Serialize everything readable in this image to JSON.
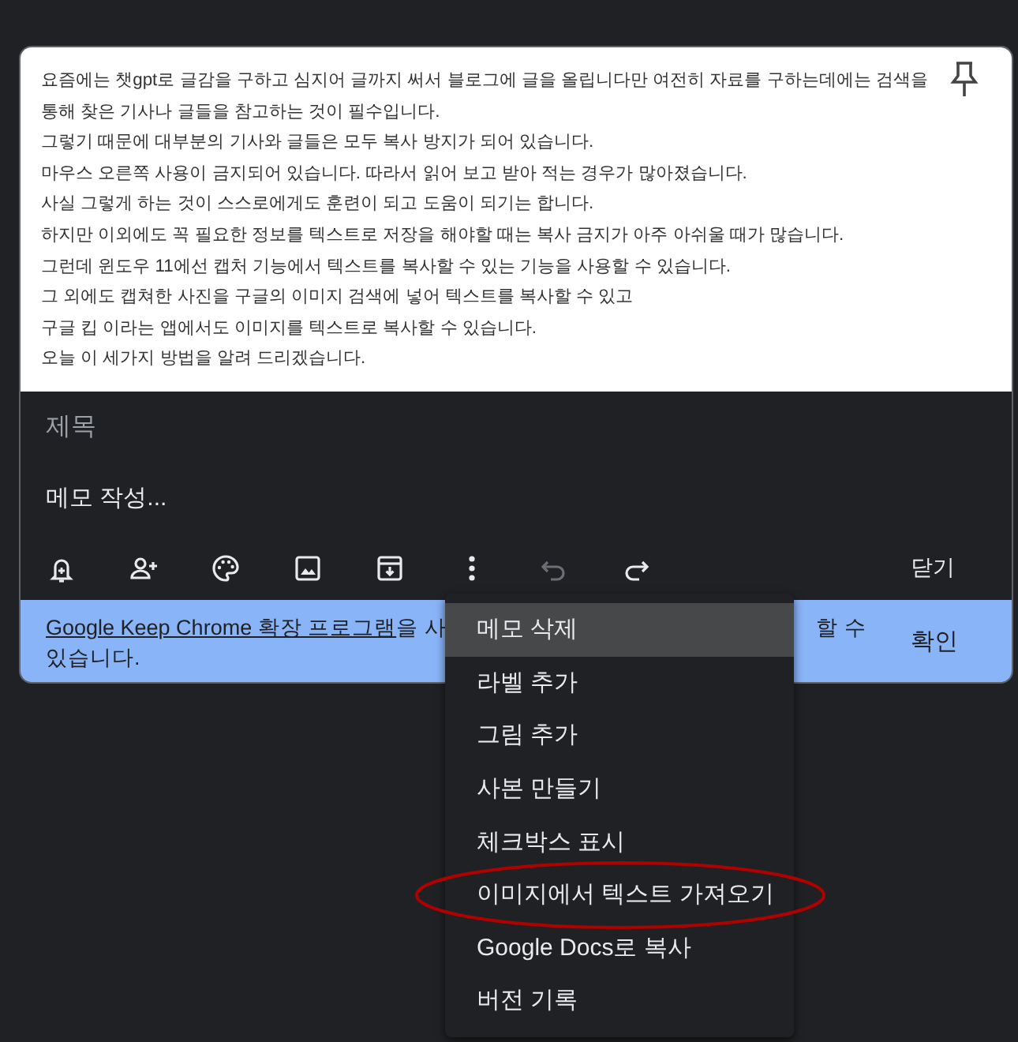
{
  "note": {
    "body": [
      "요즘에는 챗gpt로 글감을 구하고 심지어 글까지 써서 블로그에 글을 올립니다만 여전히 자료를 구하는데에는 검색을 통해 찾은 기사나 글들을 참고하는 것이 필수입니다.",
      "그렇기 때문에 대부분의 기사와 글들은 모두 복사 방지가 되어 있습니다.",
      "마우스 오른쪽 사용이 금지되어 있습니다. 따라서 읽어 보고 받아 적는 경우가 많아졌습니다.",
      "사실 그렇게 하는 것이 스스로에게도 훈련이 되고 도움이 되기는 합니다.",
      "하지만 이외에도 꼭 필요한 정보를 텍스트로 저장을 해야할 때는 복사 금지가 아주 아쉬울 때가 많습니다.",
      "그런데 윈도우 11에선 캡처 기능에서 텍스트를 복사할 수 있는 기능을 사용할 수 있습니다.",
      "그 외에도 캡쳐한 사진을 구글의 이미지 검색에 넣어 텍스트를 복사할 수 있고",
      "구글 킵 이라는 앱에서도 이미지를 텍스트로 복사할 수 있습니다.",
      "오늘 이 세가지 방법을 알려 드리겠습니다."
    ],
    "title_placeholder": "제목",
    "text_placeholder": "메모 작성...",
    "toolbar": [
      {
        "kind": "reminder",
        "disabled": false
      },
      {
        "kind": "collaborator",
        "disabled": false
      },
      {
        "kind": "color",
        "disabled": false
      },
      {
        "kind": "image",
        "disabled": false
      },
      {
        "kind": "archive",
        "disabled": false
      },
      {
        "kind": "more",
        "disabled": false
      },
      {
        "kind": "undo",
        "disabled": true
      },
      {
        "kind": "redo",
        "disabled": false
      }
    ],
    "close_button": "닫기"
  },
  "banner": {
    "link": "Google Keep Chrome 확장 프로그램",
    "text_start": "을 사",
    "text_end": "할 수",
    "text_line2": "있습니다.",
    "confirm_button": "확인"
  },
  "menu": [
    {
      "label": "메모 삭제",
      "selected": true
    },
    {
      "label": "라벨 추가",
      "selected": false
    },
    {
      "label": "그림 추가",
      "selected": false
    },
    {
      "label": "사본 만들기",
      "selected": false
    },
    {
      "label": "체크박스 표시",
      "selected": false
    },
    {
      "label": "이미지에서 텍스트 가져오기",
      "selected": false
    },
    {
      "label": "Google Docs로 복사",
      "selected": false
    },
    {
      "label": "버전 기록",
      "selected": false
    }
  ]
}
